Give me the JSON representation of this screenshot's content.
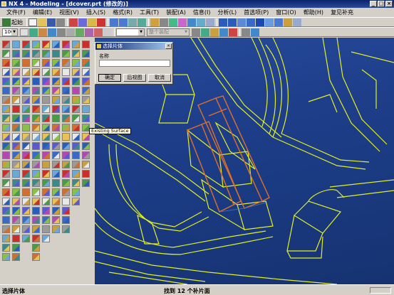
{
  "window": {
    "title": "NX 4 - Modeling - [dcover.prt (修改的)]"
  },
  "menu": [
    "文件(F)",
    "编辑(E)",
    "视图(V)",
    "插入(S)",
    "格式(R)",
    "工具(T)",
    "装配(A)",
    "信息(I)",
    "分析(L)",
    "首选项(P)",
    "窗口(O)",
    "帮助(H)",
    "复见补充"
  ],
  "toolbar": {
    "start_label": "起始",
    "zoom_value": "100",
    "filter_value": "整个装配"
  },
  "dialog": {
    "title": "选择片体",
    "name_label": "名称",
    "name_value": "",
    "ok_label": "确定",
    "back_label": "后视图",
    "cancel_label": "取消"
  },
  "tooltip": {
    "text": "Existing Surface"
  },
  "status": {
    "left": "选择片体",
    "message": "找到 12 个补片面"
  }
}
